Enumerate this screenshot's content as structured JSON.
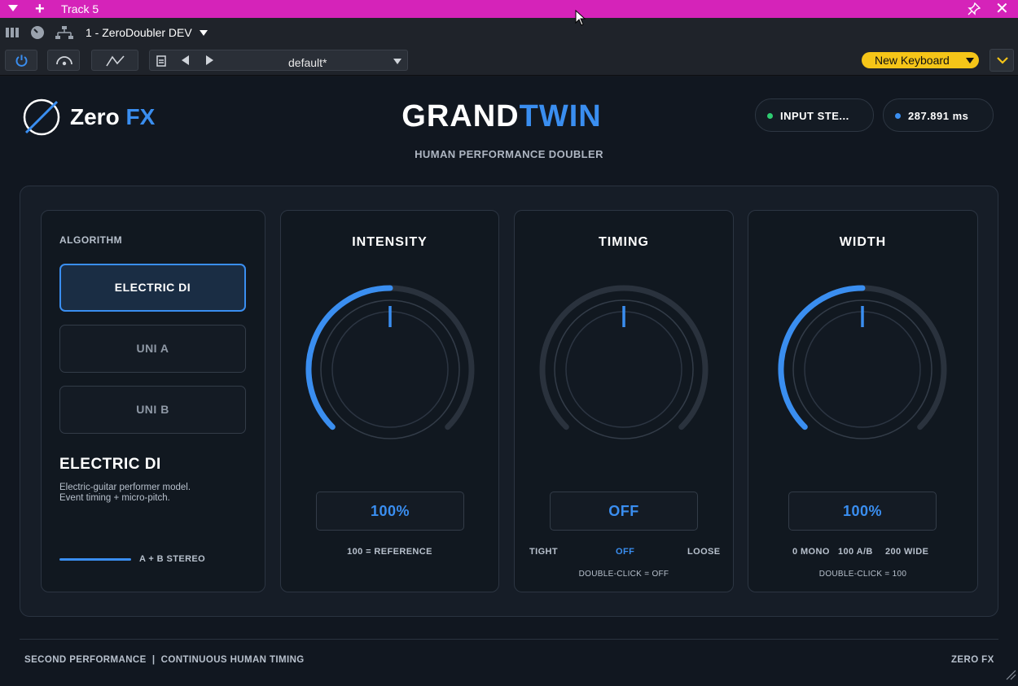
{
  "window": {
    "title": "Track 5"
  },
  "host": {
    "instrument": "1 - ZeroDoubler DEV",
    "preset": "default*",
    "keyboard": "New Keyboard"
  },
  "header": {
    "logo_zero": "Zero",
    "logo_fx": "FX",
    "title_grand": "GRAND",
    "title_twin": "TWIN",
    "subtitle": "HUMAN PERFORMANCE DOUBLER",
    "input_status": "INPUT  STE...",
    "latency": "287.891 ms"
  },
  "algorithm": {
    "label": "ALGORITHM",
    "options": [
      "ELECTRIC DI",
      "UNI A",
      "UNI B"
    ],
    "selected": "ELECTRIC DI",
    "name": "ELECTRIC DI",
    "description_line1": "Electric-guitar performer model.",
    "description_line2": "Event timing + micro-pitch.",
    "stereo_label": "A + B STEREO"
  },
  "intensity": {
    "title": "INTENSITY",
    "value": "100%",
    "level": 0.5,
    "caption": "100 = REFERENCE"
  },
  "timing": {
    "title": "TIMING",
    "value": "OFF",
    "level": 0.0,
    "cap_left": "TIGHT",
    "cap_mid": "OFF",
    "cap_right": "LOOSE",
    "hint": "DOUBLE-CLICK = OFF"
  },
  "width": {
    "title": "WIDTH",
    "value": "100%",
    "level": 0.5,
    "cap_left": "0 MONO",
    "cap_mid": "100 A/B",
    "cap_right": "200 WIDE",
    "hint": "DOUBLE-CLICK = 100"
  },
  "footer": {
    "left": "SECOND PERFORMANCE  |  CONTINUOUS HUMAN TIMING",
    "right": "ZERO FX"
  },
  "colors": {
    "accent": "#3a8ef0",
    "titlebar": "#d523b9",
    "keyboard": "#f5c518",
    "status_green": "#2ecc71"
  }
}
